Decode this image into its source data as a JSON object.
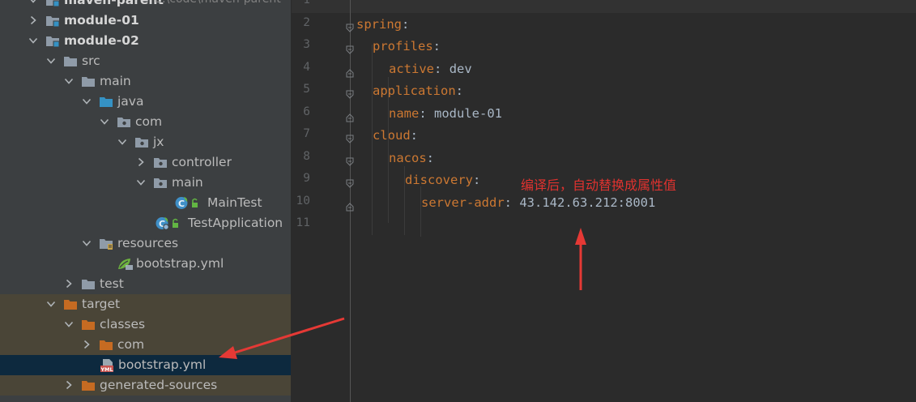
{
  "project_tree": {
    "root": {
      "label": "maven-parent",
      "path": "E:\\code\\maven-parent"
    },
    "items": [
      {
        "label": "module-01"
      },
      {
        "label": "module-02"
      },
      {
        "label": "src"
      },
      {
        "label": "main"
      },
      {
        "label": "java"
      },
      {
        "label": "com"
      },
      {
        "label": "jx"
      },
      {
        "label": "controller"
      },
      {
        "label": "main"
      },
      {
        "label": "MainTest"
      },
      {
        "label": "TestApplication"
      },
      {
        "label": "resources"
      },
      {
        "label": "bootstrap.yml"
      },
      {
        "label": "test"
      },
      {
        "label": "target"
      },
      {
        "label": "classes"
      },
      {
        "label": "com"
      },
      {
        "label": "bootstrap.yml"
      },
      {
        "label": "generated-sources"
      }
    ]
  },
  "editor": {
    "line_numbers": [
      "1",
      "2",
      "3",
      "4",
      "5",
      "6",
      "7",
      "8",
      "9",
      "10",
      "11"
    ],
    "lines": [
      {
        "key": "",
        "value": ""
      },
      {
        "key": "spring",
        "value": ""
      },
      {
        "key": "profiles",
        "value": ""
      },
      {
        "key": "active",
        "value": "dev"
      },
      {
        "key": "application",
        "value": ""
      },
      {
        "key": "name",
        "value": "module-01"
      },
      {
        "key": "cloud",
        "value": ""
      },
      {
        "key": "nacos",
        "value": ""
      },
      {
        "key": "discovery",
        "value": ""
      },
      {
        "key": "server-addr",
        "value": "43.142.63.212:8001"
      },
      {
        "key": "",
        "value": ""
      }
    ],
    "colon": ":",
    "annotation": "编译后，自动替换成属性值"
  },
  "colors": {
    "tree_bg": "#3c3f41",
    "editor_bg": "#2b2b2b",
    "yaml_key": "#cc7832",
    "yaml_value": "#a9b7c6",
    "annotation_red": "#e0322f",
    "folder_grey": "#8f9ba8",
    "folder_blue": "#3592c4",
    "folder_orange": "#c66b22",
    "selection": "#0d293e"
  },
  "icons": {
    "folder": "folder-icon",
    "module": "module-folder-icon",
    "source_root": "source-root-icon",
    "package": "package-icon",
    "resources_root": "resources-root-icon",
    "excluded": "excluded-folder-icon",
    "spring_class": "spring-class-icon",
    "spring_yaml": "spring-yaml-icon",
    "yml_file": "yml-file-icon"
  }
}
